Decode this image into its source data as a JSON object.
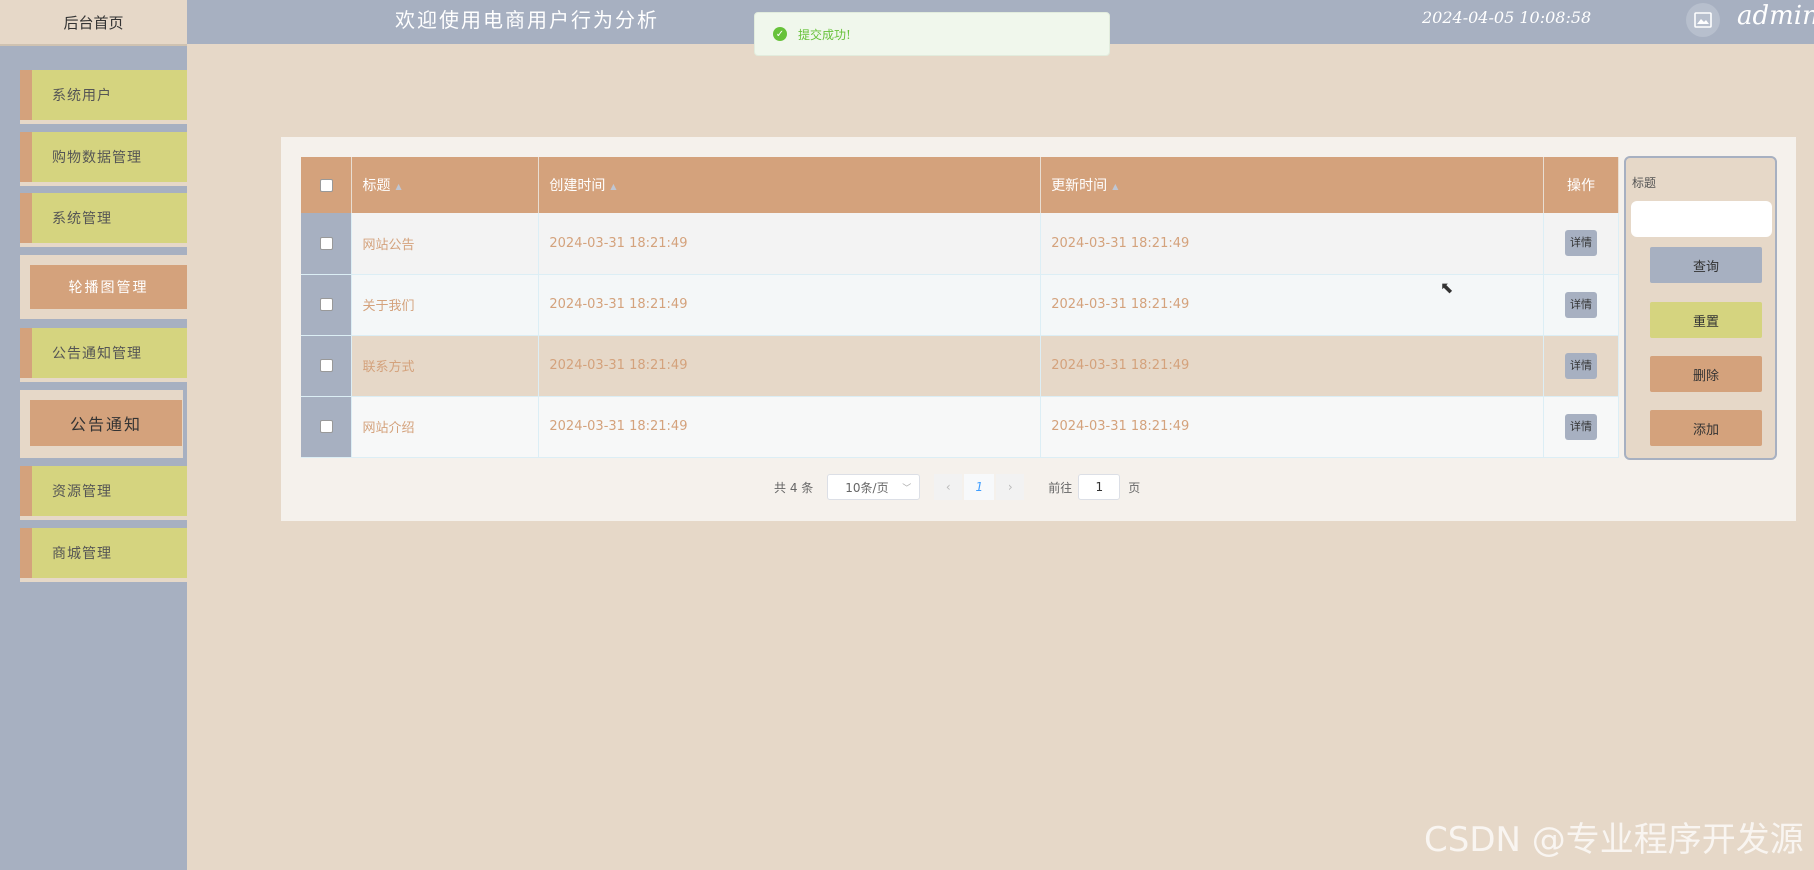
{
  "header": {
    "home": "后台首页",
    "title": "欢迎使用电商用户行为分析",
    "datetime": "2024-04-05 10:08:58",
    "username": "admin"
  },
  "toast": {
    "text": "提交成功!"
  },
  "sidebar": {
    "items": [
      {
        "label": "系统用户"
      },
      {
        "label": "购物数据管理"
      },
      {
        "label": "系统管理"
      },
      {
        "label": "轮播图管理"
      },
      {
        "label": "公告通知管理"
      },
      {
        "label": "公告通知"
      },
      {
        "label": "资源管理"
      },
      {
        "label": "商城管理"
      }
    ]
  },
  "table": {
    "columns": [
      "标题",
      "创建时间",
      "更新时间",
      "操作"
    ],
    "rows": [
      {
        "title": "网站公告",
        "created": "2024-03-31 18:21:49",
        "updated": "2024-03-31 18:21:49",
        "action": "详情"
      },
      {
        "title": "关于我们",
        "created": "2024-03-31 18:21:49",
        "updated": "2024-03-31 18:21:49",
        "action": "详情"
      },
      {
        "title": "联系方式",
        "created": "2024-03-31 18:21:49",
        "updated": "2024-03-31 18:21:49",
        "action": "详情"
      },
      {
        "title": "网站介绍",
        "created": "2024-03-31 18:21:49",
        "updated": "2024-03-31 18:21:49",
        "action": "详情"
      }
    ]
  },
  "pagination": {
    "total": "共 4 条",
    "page_size": "10条/页",
    "current": "1",
    "goto_label": "前往",
    "goto_value": "1",
    "page_suffix": "页"
  },
  "search": {
    "label": "标题",
    "value": "",
    "query": "查询",
    "reset": "重置",
    "delete": "删除",
    "add": "添加"
  },
  "watermark": "CSDN @专业程序开发源",
  "colors": {
    "accent_tan": "#d4a27c",
    "accent_olive": "#d5d47f",
    "slate": "#a7b0c1",
    "background": "#e6d8c8"
  }
}
